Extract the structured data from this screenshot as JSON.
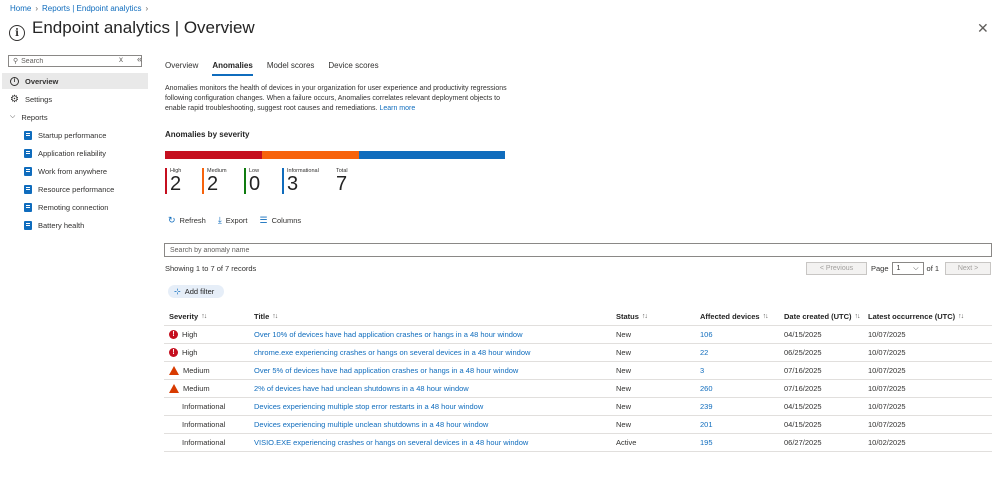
{
  "breadcrumb": {
    "home": "Home",
    "reports": "Reports | Endpoint analytics"
  },
  "header": {
    "title": "Endpoint analytics | Overview",
    "more": "···",
    "close": "✕"
  },
  "sidebar": {
    "search_placeholder": "Search",
    "clear": "x",
    "collapse": "«",
    "items": [
      {
        "label": "Overview",
        "icon": "info-icon",
        "active": true
      },
      {
        "label": "Settings",
        "icon": "gear-icon"
      },
      {
        "label": "Reports",
        "icon": "chevron-down-icon"
      },
      {
        "label": "Startup performance",
        "icon": "report-icon"
      },
      {
        "label": "Application reliability",
        "icon": "report-icon"
      },
      {
        "label": "Work from anywhere",
        "icon": "report-icon"
      },
      {
        "label": "Resource performance",
        "icon": "report-icon"
      },
      {
        "label": "Remoting connection",
        "icon": "report-icon"
      },
      {
        "label": "Battery health",
        "icon": "report-icon"
      }
    ]
  },
  "tabs": [
    {
      "label": "Overview"
    },
    {
      "label": "Anomalies",
      "active": true
    },
    {
      "label": "Model scores"
    },
    {
      "label": "Device scores"
    }
  ],
  "description": {
    "text": "Anomalies monitors the health of devices in your organization for user experience and productivity regressions following configuration changes. When a failure occurs, Anomalies correlates relevant deployment objects to enable rapid troubleshooting, suggest root causes and remediations.",
    "link": "Learn more"
  },
  "severity_summary": {
    "title": "Anomalies by severity",
    "stats": [
      {
        "label": "High",
        "value": "2",
        "color": "#c50f1f"
      },
      {
        "label": "Medium",
        "value": "2",
        "color": "#f7630c"
      },
      {
        "label": "Low",
        "value": "0",
        "color": "#107c10"
      },
      {
        "label": "Informational",
        "value": "3",
        "color": "#0f6cbd"
      },
      {
        "label": "Total",
        "value": "7"
      }
    ]
  },
  "toolbar": {
    "refresh": "Refresh",
    "export": "Export",
    "columns": "Columns"
  },
  "grid": {
    "search_placeholder": "Search by anomaly name",
    "records": "Showing 1 to 7 of 7 records",
    "add_filter": "Add filter",
    "pager": {
      "previous": "< Previous",
      "page_label": "Page",
      "page": "1",
      "of": "of 1",
      "next": "Next >"
    },
    "columns": [
      "Severity",
      "Title",
      "Status",
      "Affected devices",
      "Date created (UTC)",
      "Latest occurrence (UTC)"
    ],
    "rows": [
      {
        "severity": "High",
        "title": "Over 10% of devices have had application crashes or hangs in a 48 hour window",
        "status": "New",
        "affected": "106",
        "created": "04/15/2025",
        "latest": "10/07/2025"
      },
      {
        "severity": "High",
        "title": "chrome.exe experiencing crashes or hangs on several devices in a 48 hour window",
        "status": "New",
        "affected": "22",
        "created": "06/25/2025",
        "latest": "10/07/2025"
      },
      {
        "severity": "Medium",
        "title": "Over 5% of devices have had application crashes or hangs in a 48 hour window",
        "status": "New",
        "affected": "3",
        "created": "07/16/2025",
        "latest": "10/07/2025"
      },
      {
        "severity": "Medium",
        "title": "2% of devices have had unclean shutdowns in a 48 hour window",
        "status": "New",
        "affected": "260",
        "created": "07/16/2025",
        "latest": "10/07/2025"
      },
      {
        "severity": "Informational",
        "title": "Devices experiencing multiple stop error restarts in a 48 hour window",
        "status": "New",
        "affected": "239",
        "created": "04/15/2025",
        "latest": "10/07/2025"
      },
      {
        "severity": "Informational",
        "title": "Devices experiencing multiple unclean shutdowns in a 48 hour window",
        "status": "New",
        "affected": "201",
        "created": "04/15/2025",
        "latest": "10/07/2025"
      },
      {
        "severity": "Informational",
        "title": "VISIO.EXE experiencing crashes or hangs on several devices in a 48 hour window",
        "status": "Active",
        "affected": "195",
        "created": "06/27/2025",
        "latest": "10/02/2025"
      }
    ]
  }
}
